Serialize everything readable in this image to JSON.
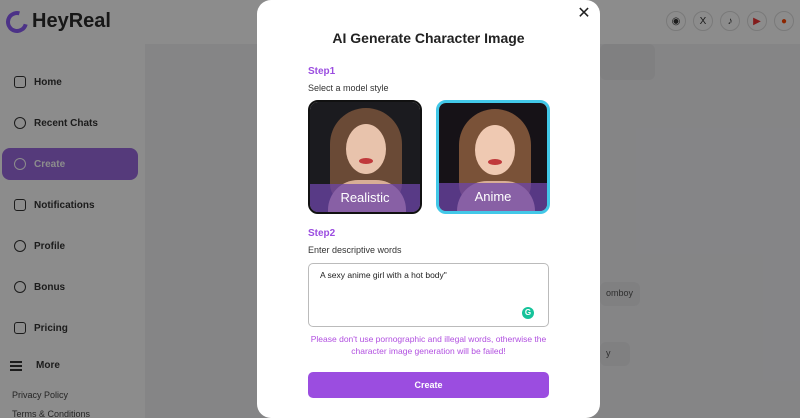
{
  "app": {
    "brand": "HeyReal",
    "nav": [
      {
        "label": "Home",
        "icon": "home-icon"
      },
      {
        "label": "Recent Chats",
        "icon": "chat-icon"
      },
      {
        "label": "Create",
        "icon": "plus-circle-icon",
        "active": true
      },
      {
        "label": "Notifications",
        "icon": "bell-icon"
      },
      {
        "label": "Profile",
        "icon": "user-icon"
      },
      {
        "label": "Bonus",
        "icon": "dollar-icon"
      },
      {
        "label": "Pricing",
        "icon": "calendar-icon"
      }
    ],
    "more_label": "More",
    "footer_links": [
      "Privacy Policy",
      "Terms & Conditions"
    ],
    "social": [
      {
        "name": "discord-icon",
        "glyph": "◉"
      },
      {
        "name": "x-icon",
        "glyph": "X"
      },
      {
        "name": "tiktok-icon",
        "glyph": "♪"
      },
      {
        "name": "youtube-icon",
        "glyph": "▶"
      },
      {
        "name": "reddit-icon",
        "glyph": "●"
      }
    ],
    "accent_color": "#9b6ae0",
    "background_fragments": [
      "omboy",
      "y"
    ]
  },
  "modal": {
    "title": "AI Generate Character Image",
    "close_label": "✕",
    "step1": {
      "label": "Step1",
      "hint": "Select a model style",
      "options": [
        {
          "label": "Realistic",
          "selected": false
        },
        {
          "label": "Anime",
          "selected": true
        }
      ]
    },
    "step2": {
      "label": "Step2",
      "hint": "Enter descriptive words",
      "value": "A sexy anime girl with a hot body\""
    },
    "warning": "Please don't use pornographic and illegal words, otherwise the character image generation will be failed!",
    "create_label": "Create",
    "accent_color": "#9b4de0",
    "selected_border_color": "#42c8e8"
  }
}
